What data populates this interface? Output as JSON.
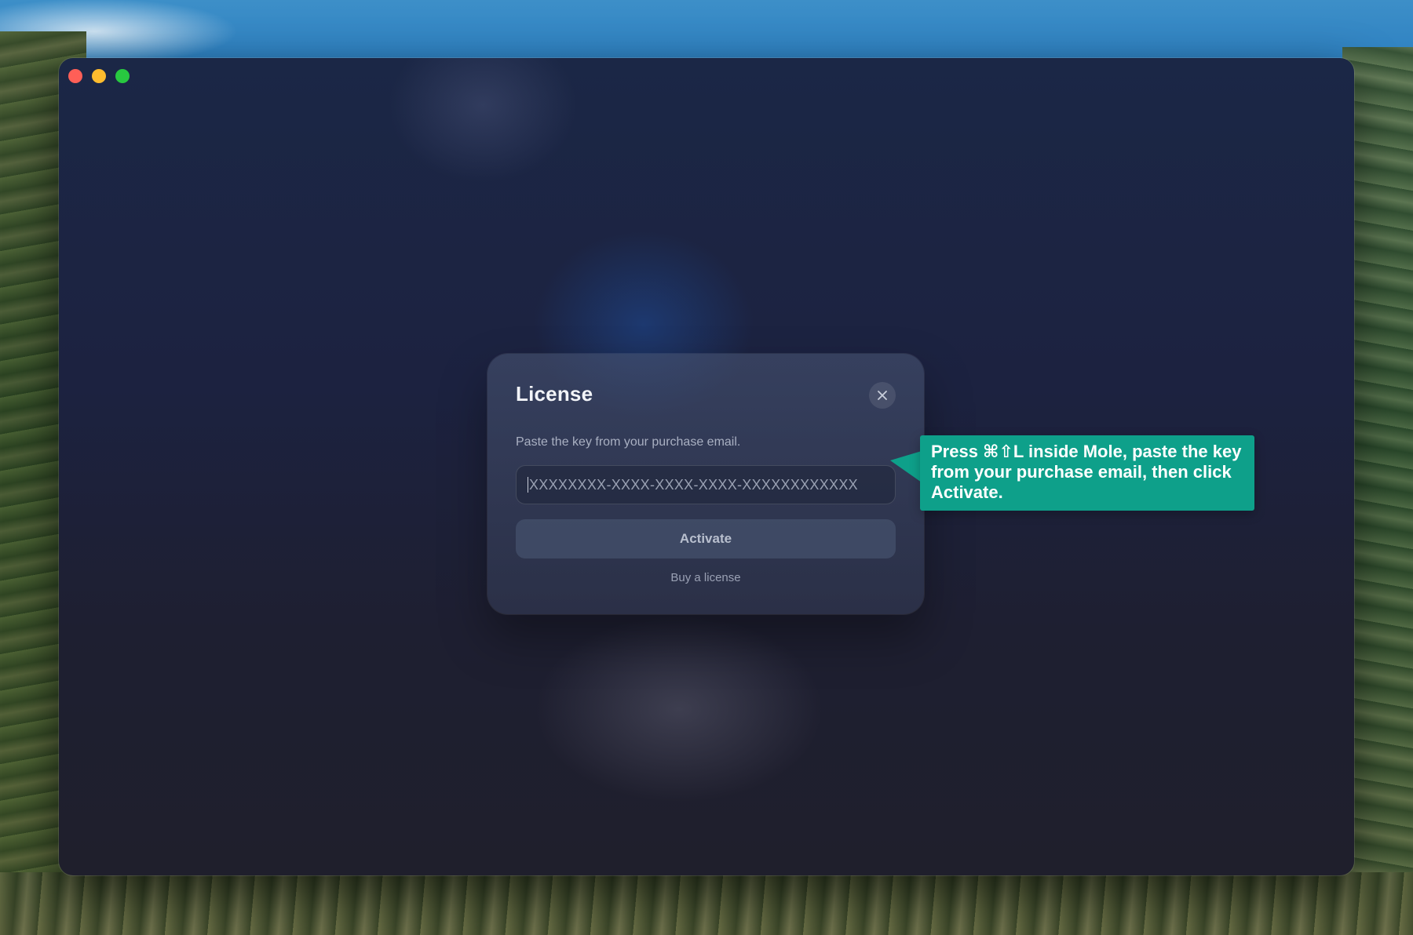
{
  "window": {
    "controls": [
      "close",
      "minimize",
      "zoom"
    ]
  },
  "dialog": {
    "title": "License",
    "subtitle": "Paste the key from your purchase email.",
    "key_input": {
      "placeholder": "XXXXXXXX-XXXX-XXXX-XXXX-XXXXXXXXXXXX",
      "value": ""
    },
    "activate_label": "Activate",
    "buy_link_label": "Buy a license",
    "close_icon": "close-icon"
  },
  "callout": {
    "text": "Press ⌘⇧L inside Mole, paste the key from your purchase email, then click Activate.",
    "color": "#0ea08a"
  },
  "colors": {
    "traffic_red": "#ff5f57",
    "traffic_yellow": "#febc2e",
    "traffic_green": "#28c840"
  }
}
